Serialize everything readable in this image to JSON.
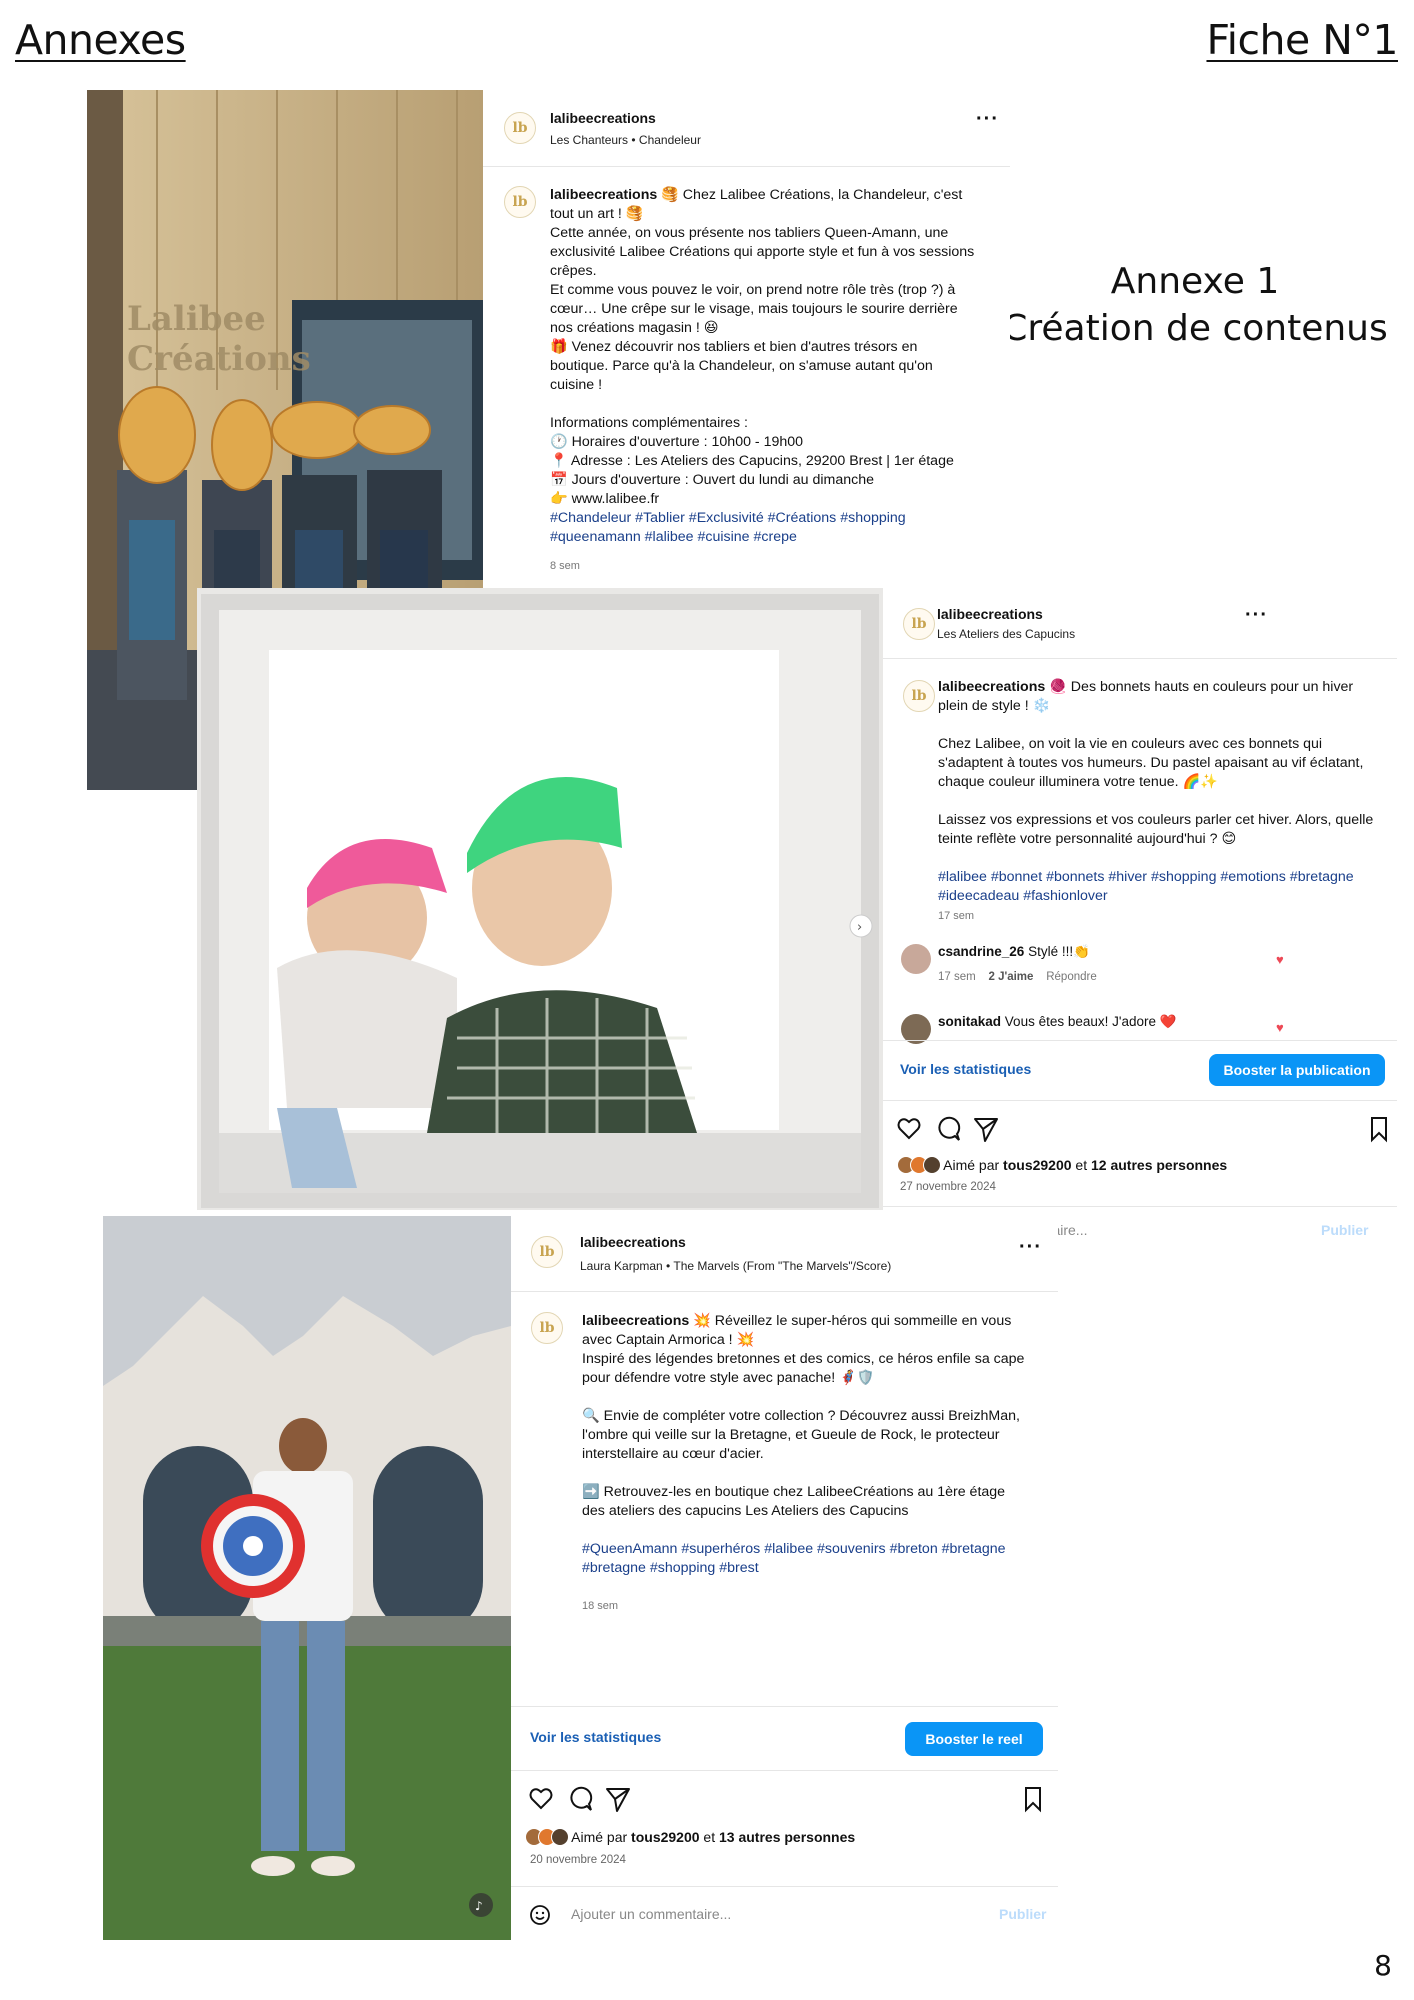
{
  "page": {
    "header_left": "Annexes",
    "header_right": "Fiche N°1",
    "annexe_title_line1": "Annexe 1",
    "annexe_title_line2": "Création de contenus",
    "page_number": "8"
  },
  "post1": {
    "username": "lalibeecreations",
    "music": "Les Chanteurs • Chandeleur",
    "photo_sign": "Lalibee Créations",
    "caption_user": "lalibeecreations",
    "caption_lines": [
      "🥞 Chez Lalibee Créations, la Chandeleur, c'est tout un art ! 🥞",
      "Cette année, on vous présente nos tabliers Queen-Amann, une exclusivité Lalibee Créations qui apporte style et fun à vos sessions crêpes.",
      "Et comme vous pouvez le voir, on prend notre rôle très (trop ?) à cœur… Une crêpe sur le visage, mais toujours le sourire derrière nos créations magasin ! 😆",
      "🎁 Venez découvrir nos tabliers et bien d'autres trésors en boutique. Parce qu'à la Chandeleur, on s'amuse autant qu'on cuisine !",
      "",
      "Informations complémentaires :",
      "🕐 Horaires d'ouverture : 10h00 - 19h00",
      "📍 Adresse : Les Ateliers des Capucins, 29200 Brest | 1er étage",
      "📅 Jours d'ouverture : Ouvert du lundi au dimanche",
      "👉 www.lalibee.fr"
    ],
    "hashtags": "#Chandeleur #Tablier #Exclusivité #Créations #shopping #queenamann #lalibee #cuisine #crepe",
    "time": "8 sem"
  },
  "post2": {
    "username": "lalibeecreations",
    "location": "Les Ateliers des Capucins",
    "caption_user": "lalibeecreations",
    "caption_p1": "🧶 Des bonnets hauts en couleurs pour un hiver plein de style ! ❄️",
    "caption_p2": "Chez Lalibee, on voit la vie en couleurs avec ces bonnets qui s'adaptent à toutes vos humeurs. Du pastel apaisant au vif éclatant, chaque couleur illuminera votre tenue. 🌈✨",
    "caption_p3": "Laissez vos expressions et vos couleurs parler cet hiver. Alors, quelle teinte reflète votre personnalité aujourd'hui ? 😊",
    "hashtags": "#lalibee #bonnet #bonnets #hiver #shopping #emotions #bretagne #ideecadeau #fashionlover",
    "time": "17 sem",
    "comments": [
      {
        "user": "csandrine_26",
        "text": "Stylé !!!👏",
        "time": "17 sem",
        "likes": "2 J'aime",
        "reply": "Répondre"
      },
      {
        "user": "sonitakad",
        "text": "Vous êtes beaux! J'adore ❤️"
      }
    ],
    "stats_link": "Voir les statistiques",
    "boost_label": "Booster la publication",
    "liked_by_prefix": "Aimé par",
    "liked_by_user": "tous29200",
    "liked_by_and": "et",
    "liked_by_others": "12 autres personnes",
    "date": "27 novembre 2024",
    "comment_placeholder": "…entaire...",
    "publish_label": "Publier"
  },
  "post3": {
    "username": "lalibeecreations",
    "music": "Laura Karpman • The Marvels (From \"The Marvels\"/Score)",
    "caption_user": "lalibeecreations",
    "caption_p1": "💥 Réveillez le super-héros qui sommeille en vous avec Captain Armorica ! 💥",
    "caption_p1b": "Inspiré des légendes bretonnes et des comics, ce héros enfile sa cape pour défendre votre style avec panache! 🦸🛡️",
    "caption_p2": "🔍 Envie de compléter votre collection ? Découvrez aussi BreizhMan, l'ombre qui veille sur la Bretagne, et Gueule de Rock, le protecteur interstellaire au cœur d'acier.",
    "caption_p3": "➡️ Retrouvez-les en boutique chez LalibeeCréations au 1ère étage des ateliers des capucins Les Ateliers des Capucins",
    "hashtags": "#QueenAmann #superhéros #lalibee #souvenirs #breton #bretagne #bretagne #shopping #brest",
    "time": "18 sem",
    "stats_link": "Voir les statistiques",
    "boost_label": "Booster le reel",
    "liked_by_prefix": "Aimé par",
    "liked_by_user": "tous29200",
    "liked_by_and": "et",
    "liked_by_others": "13 autres personnes",
    "date": "20 novembre 2024",
    "comment_placeholder": "Ajouter un commentaire...",
    "publish_label": "Publier"
  },
  "colors": {
    "accent_blue": "#0a95f6",
    "link_blue": "#1a5fb4",
    "hashtag_blue": "#1a3f8a",
    "heart_red": "#ed4956",
    "logo_gold": "#c8a450"
  }
}
